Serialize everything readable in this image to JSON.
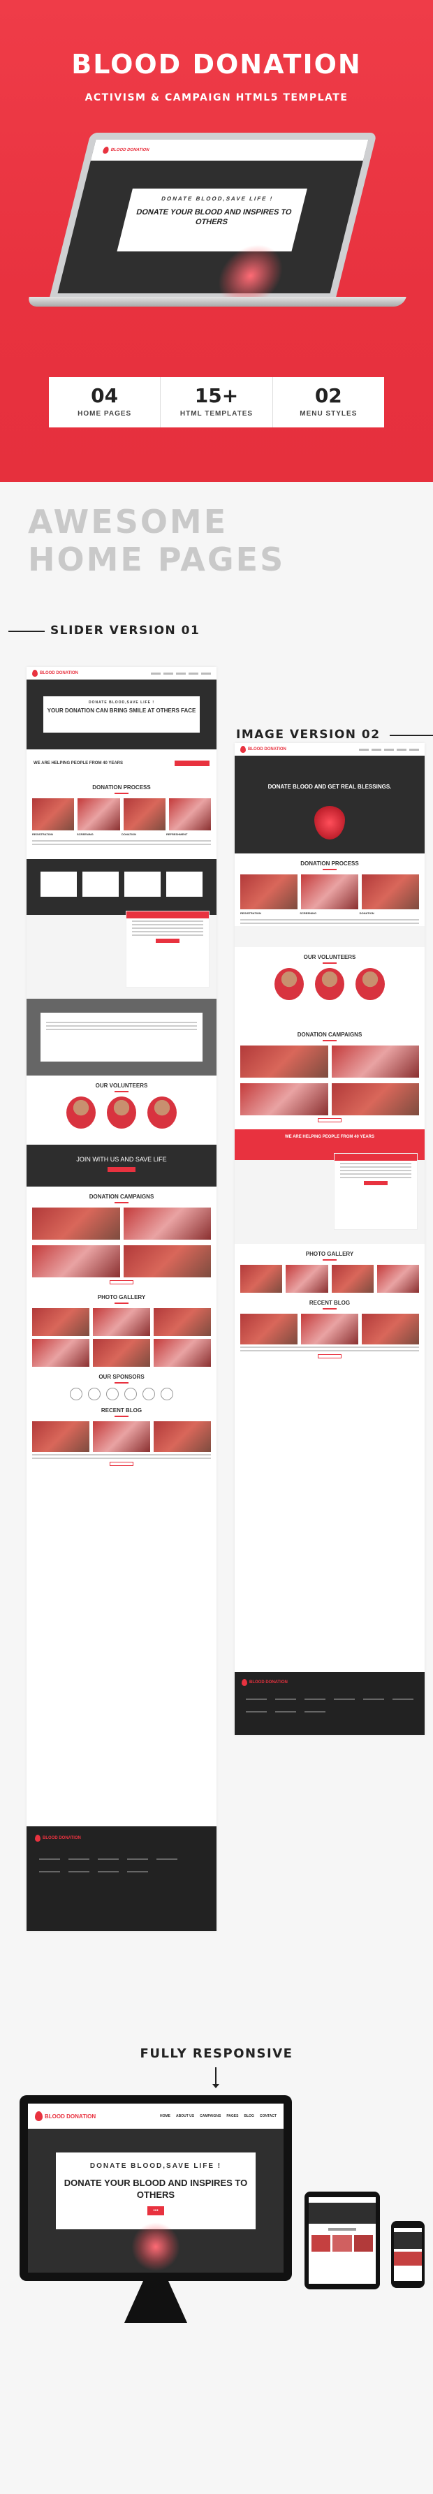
{
  "hero": {
    "title": "BLOOD DONATION",
    "subtitle": "ACTIVISM & CAMPAIGN HTML5 TEMPLATE",
    "laptop_kicker": "DONATE BLOOD,SAVE LIFE !",
    "laptop_heading": "DONATE YOUR BLOOD AND INSPIRES TO OTHERS",
    "stats": [
      {
        "num": "04",
        "label": "HOME PAGES"
      },
      {
        "num": "15+",
        "label": "HTML TEMPLATES"
      },
      {
        "num": "02",
        "label": "MENU STYLES"
      }
    ],
    "colors": {
      "brand_red": "#e8323f"
    }
  },
  "section_heading": [
    "AWESOME",
    "HOME PAGES"
  ],
  "slider_version": {
    "label": "SLIDER VERSION 01",
    "banner_kicker": "DONATE BLOOD,SAVE LIFE !",
    "banner_heading": "YOUR DONATION CAN BRING SMILE AT OTHERS FACE",
    "helping_text": "WE ARE HELPING PEOPLE FROM 40 YEARS",
    "donation_process": "DONATION PROCESS",
    "steps": [
      "REGISTRATION",
      "SCREENING",
      "DONATION",
      "REFRESHMENT"
    ],
    "volunteers": "OUR VOLUNTEERS",
    "join": "JOIN WITH US AND SAVE LIFE",
    "campaigns": "DONATION CAMPAIGNS",
    "gallery": "PHOTO GALLERY",
    "sponsors": "OUR SPONSORS",
    "blog": "RECENT BLOG"
  },
  "image_version": {
    "label": "IMAGE VERSION 02",
    "banner_heading": "DONATE BLOOD AND GET REAL BLESSINGS.",
    "donation_process": "DONATION PROCESS",
    "steps": [
      "REGISTRATION",
      "SCREENING",
      "DONATION"
    ],
    "volunteers": "OUR VOLUNTEERS",
    "campaigns": "DONATION CAMPAIGNS",
    "helping_text": "WE ARE HELPING PEOPLE FROM 40 YEARS",
    "gallery": "PHOTO GALLERY",
    "blog": "RECENT BLOG"
  },
  "mini_logo": "BLOOD DONATION",
  "responsive": {
    "title": "FULLY RESPONSIVE",
    "kicker": "DONATE BLOOD,SAVE LIFE !",
    "heading": "DONATE YOUR BLOOD AND INSPIRES TO OTHERS",
    "menu": [
      "HOME",
      "ABOUT US",
      "CAMPAIGNS",
      "PAGES",
      "BLOG",
      "CONTACT"
    ]
  }
}
